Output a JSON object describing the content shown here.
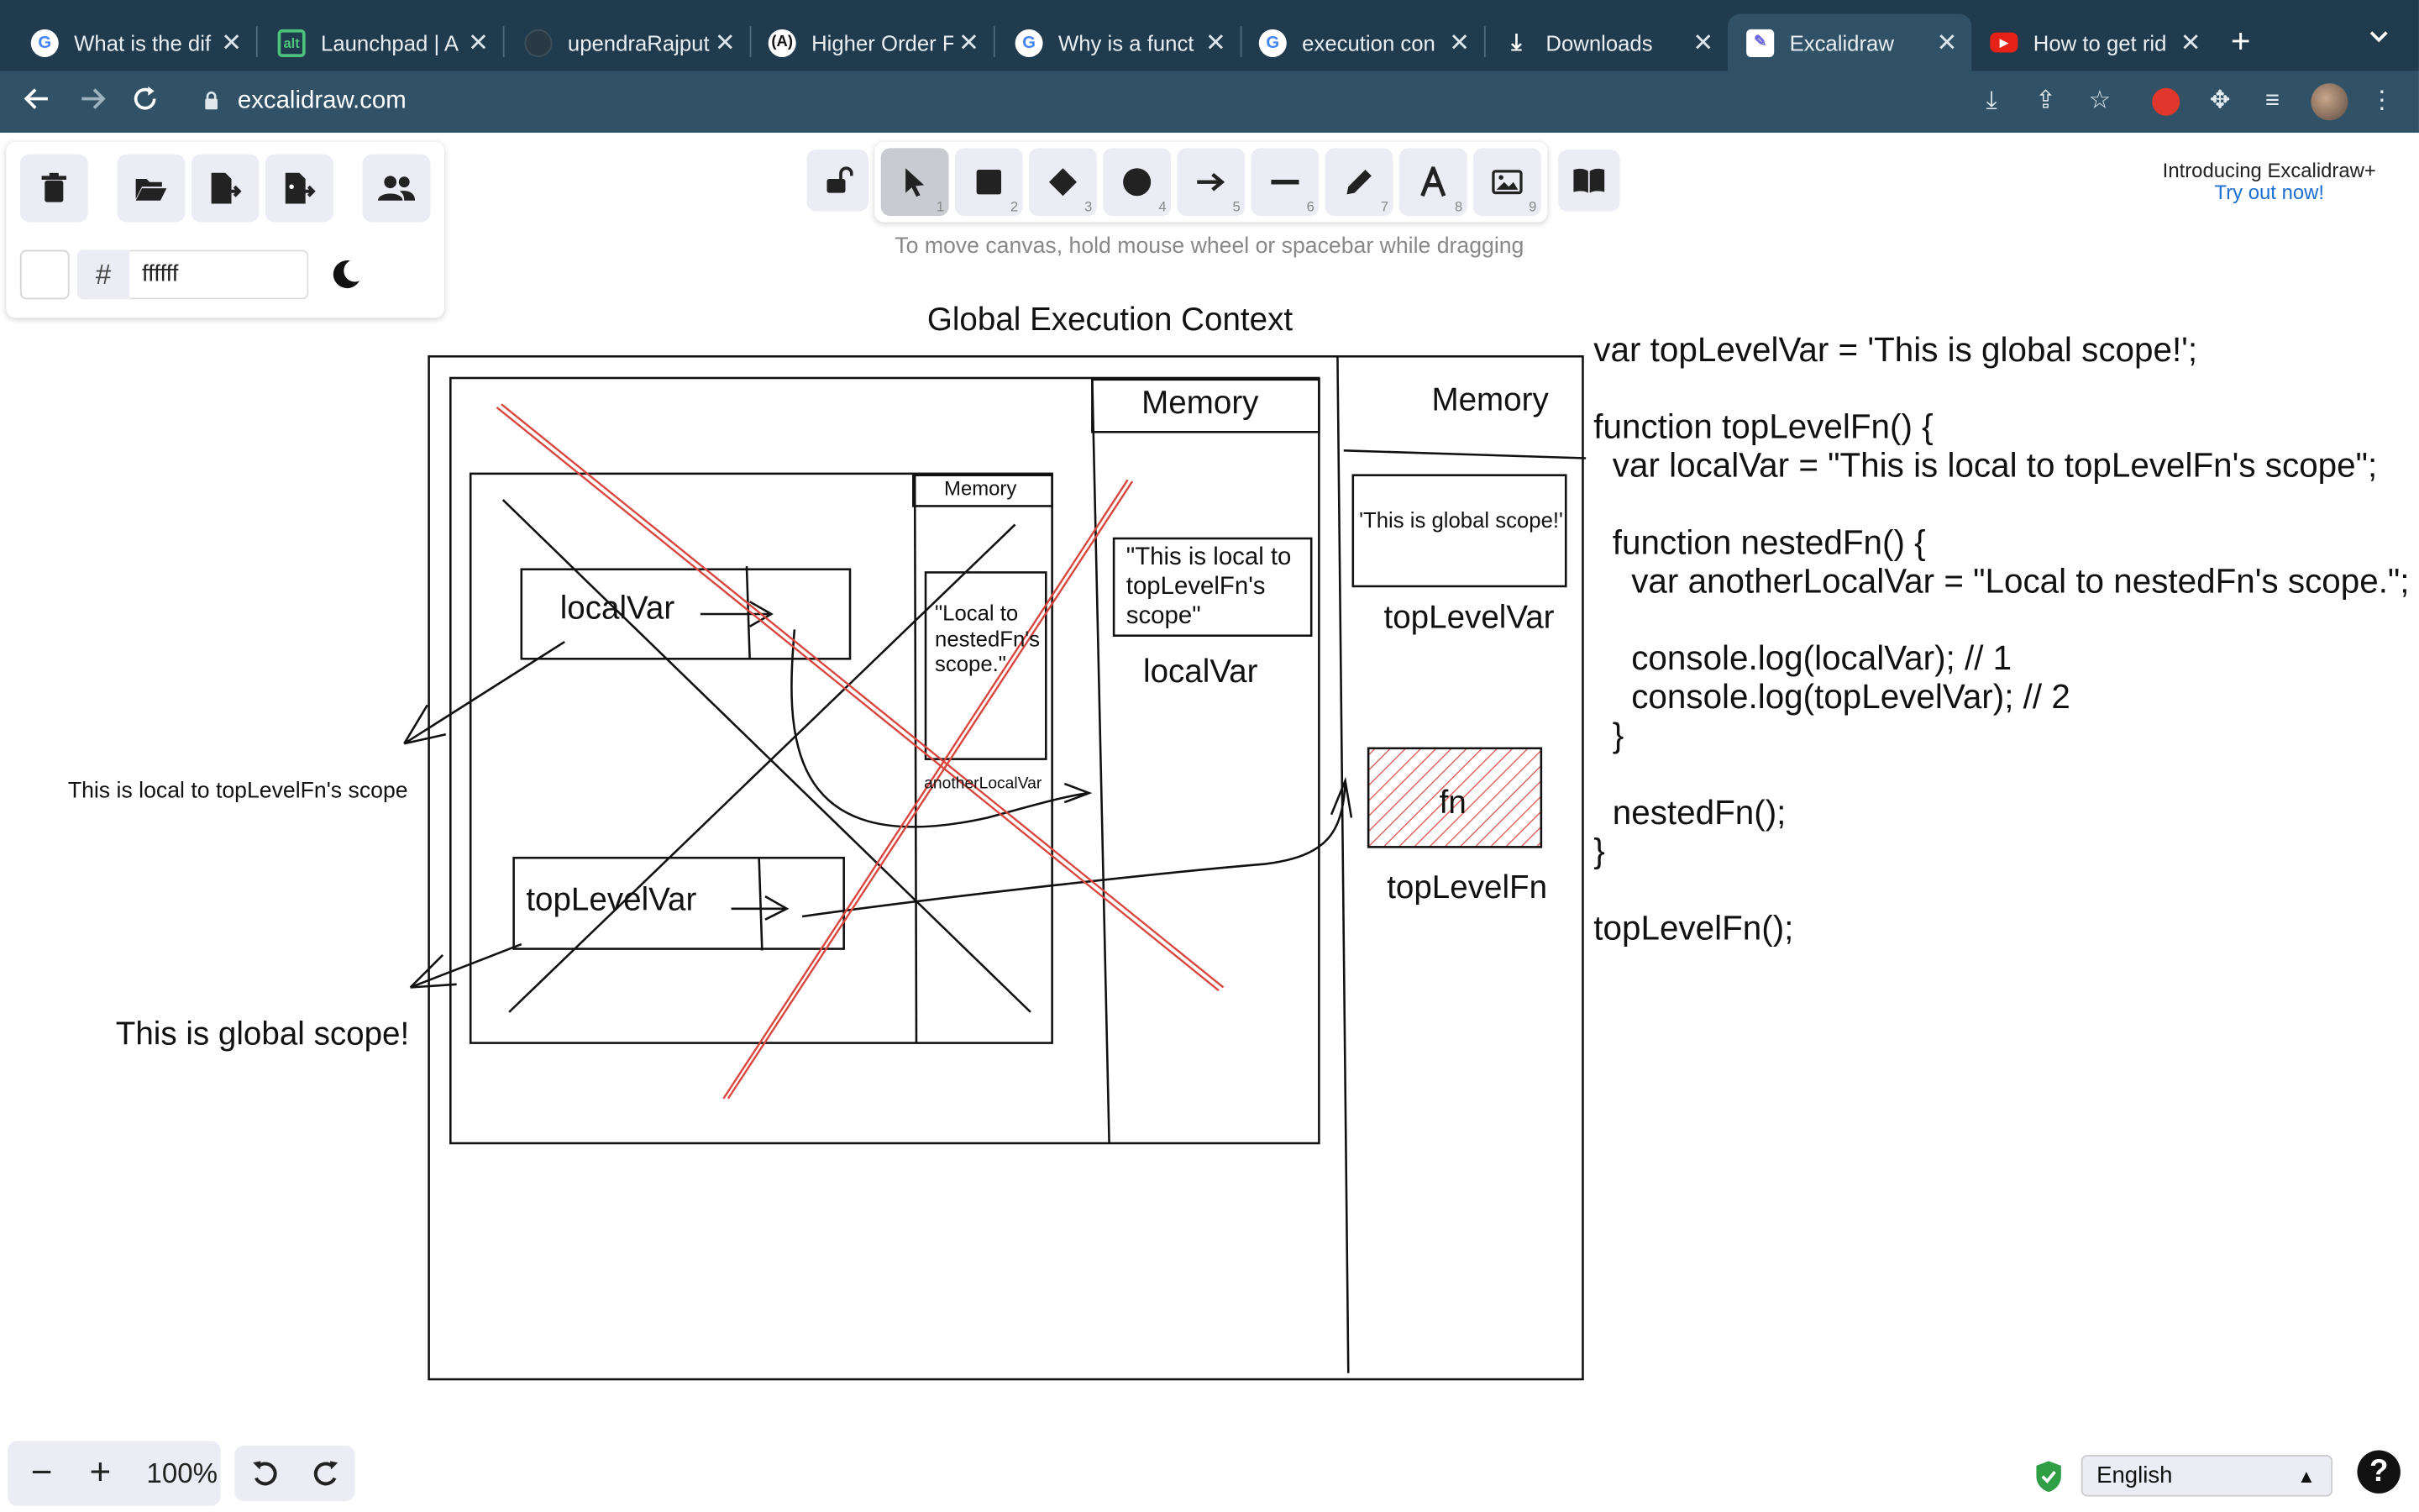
{
  "browser": {
    "tabs": [
      {
        "title": "What is the dif",
        "icon": "google-icon",
        "active": false
      },
      {
        "title": "Launchpad | A",
        "icon": "launchpad-icon",
        "active": false
      },
      {
        "title": "upendraRajput",
        "icon": "github-icon",
        "active": false
      },
      {
        "title": "Higher Order F",
        "icon": "dev-icon",
        "active": false
      },
      {
        "title": "Why is a funct",
        "icon": "google-icon",
        "active": false
      },
      {
        "title": "execution con",
        "icon": "google-icon",
        "active": false
      },
      {
        "title": "Downloads",
        "icon": "download-icon",
        "active": false
      },
      {
        "title": "Excalidraw",
        "icon": "excalidraw-icon",
        "active": true
      },
      {
        "title": "How to get rid",
        "icon": "youtube-icon",
        "active": false
      }
    ],
    "url": "excalidraw.com"
  },
  "panel": {
    "hex_hash": "#",
    "hex_value": "ffffff"
  },
  "tools": {
    "numbers": [
      "1",
      "2",
      "3",
      "4",
      "5",
      "6",
      "7",
      "8",
      "9"
    ],
    "hint": "To move canvas, hold mouse wheel or spacebar while dragging"
  },
  "promo": {
    "line1": "Introducing Excalidraw+",
    "line2": "Try out now!"
  },
  "canvas": {
    "title": "Global Execution Context",
    "memory_outer": "Memory",
    "memory_mid": "Memory",
    "memory_inner": "Memory",
    "global_box_value": "'This is global scope!'",
    "top_level_var_label": "topLevelVar",
    "local_box_value": "\"This is local to topLevelFn's scope\"",
    "local_var_label": "localVar",
    "fn_box": "fn",
    "top_level_fn_label": "topLevelFn",
    "nested_box_value": "\"Local to nestedFn's scope.\"",
    "another_local_label": "anotherLocalVar",
    "exec_local_var": "localVar",
    "exec_top_level_var": "topLevelVar",
    "side_local_text": "This is local to topLevelFn's scope",
    "side_global_text": "This is global scope!",
    "code": "var topLevelVar = 'This is global scope!';\n\nfunction topLevelFn() {\n  var localVar = \"This is local to topLevelFn's scope\";\n\n  function nestedFn() {\n    var anotherLocalVar = \"Local to nestedFn's scope.\";\n\n    console.log(localVar); // 1\n    console.log(topLevelVar); // 2\n  }\n\n  nestedFn();\n}\n\ntopLevelFn();"
  },
  "bottom": {
    "zoom_minus": "−",
    "zoom_plus": "+",
    "zoom_value": "100%",
    "language": "English"
  },
  "colors": {
    "tab_bar": "#1f3b4d",
    "toolbar": "#315266",
    "accent_blue": "#1c6fd1",
    "red_stroke": "#d9463e",
    "tool_bg": "#ececf4"
  }
}
